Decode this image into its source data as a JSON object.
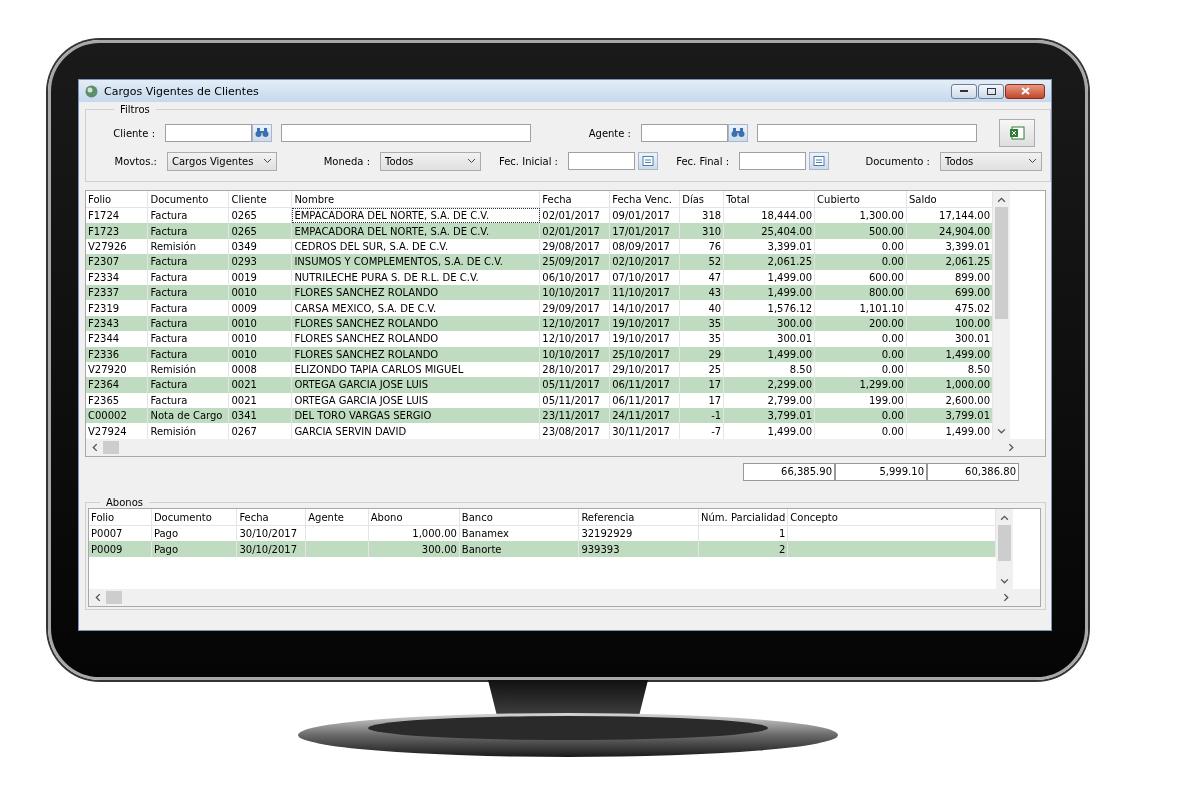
{
  "window": {
    "title": "Cargos Vigentes de Clientes"
  },
  "filters": {
    "title": "Filtros",
    "row_1": [
      {
        "kind": "lookup",
        "label": "Cliente :"
      },
      {
        "kind": "lookup",
        "label": "Agente :"
      },
      {
        "kind": "export"
      }
    ],
    "row_2": [
      {
        "kind": "combo",
        "label": "Movtos.:",
        "value": "Cargos Vigentes"
      },
      {
        "kind": "combo",
        "label": "Moneda :",
        "value": "Todos"
      },
      {
        "kind": "date",
        "label": "Fec. Inicial :"
      },
      {
        "kind": "date",
        "label": "Fec. Final :"
      },
      {
        "kind": "combo",
        "label": "Documento :",
        "value": "Todos"
      }
    ]
  },
  "table": {
    "columns": [
      {
        "label": "Folio",
        "kind": "text"
      },
      {
        "label": "Documento",
        "kind": "text"
      },
      {
        "label": "Cliente",
        "kind": "text"
      },
      {
        "label": "Nombre",
        "kind": "text"
      },
      {
        "label": "Fecha",
        "kind": "text"
      },
      {
        "label": "Fecha Venc.",
        "kind": "text"
      },
      {
        "label": "Días",
        "kind": "number"
      },
      {
        "label": "Total",
        "kind": "number"
      },
      {
        "label": "Cubierto",
        "kind": "number"
      },
      {
        "label": "Saldo",
        "kind": "number"
      }
    ],
    "rows": [
      {
        "cells": [
          "F1724",
          "Factura",
          "0265",
          "EMPACADORA DEL NORTE, S.A. DE C.V.",
          "02/01/2017",
          "09/01/2017",
          "318",
          "18,444.00",
          "1,300.00",
          "17,144.00"
        ],
        "focused": true
      },
      {
        "cells": [
          "F1723",
          "Factura",
          "0265",
          "EMPACADORA DEL NORTE, S.A. DE C.V.",
          "02/01/2017",
          "17/01/2017",
          "310",
          "25,404.00",
          "500.00",
          "24,904.00"
        ],
        "focused": false
      },
      {
        "cells": [
          "V27926",
          "Remisión",
          "0349",
          "CEDROS DEL SUR, S.A. DE C.V.",
          "29/08/2017",
          "08/09/2017",
          "76",
          "3,399.01",
          "0.00",
          "3,399.01"
        ],
        "focused": false
      },
      {
        "cells": [
          "F2307",
          "Factura",
          "0293",
          "INSUMOS Y COMPLEMENTOS, S.A. DE C.V.",
          "25/09/2017",
          "02/10/2017",
          "52",
          "2,061.25",
          "0.00",
          "2,061.25"
        ],
        "focused": false
      },
      {
        "cells": [
          "F2334",
          "Factura",
          "0019",
          "NUTRILECHE PURA S. DE R.L. DE C.V.",
          "06/10/2017",
          "07/10/2017",
          "47",
          "1,499.00",
          "600.00",
          "899.00"
        ],
        "focused": false
      },
      {
        "cells": [
          "F2337",
          "Factura",
          "0010",
          "FLORES SANCHEZ ROLANDO",
          "10/10/2017",
          "11/10/2017",
          "43",
          "1,499.00",
          "800.00",
          "699.00"
        ],
        "focused": false
      },
      {
        "cells": [
          "F2319",
          "Factura",
          "0009",
          "CARSA MEXICO, S.A. DE C.V.",
          "29/09/2017",
          "14/10/2017",
          "40",
          "1,576.12",
          "1,101.10",
          "475.02"
        ],
        "focused": false
      },
      {
        "cells": [
          "F2343",
          "Factura",
          "0010",
          "FLORES SANCHEZ ROLANDO",
          "12/10/2017",
          "19/10/2017",
          "35",
          "300.00",
          "200.00",
          "100.00"
        ],
        "focused": false
      },
      {
        "cells": [
          "F2344",
          "Factura",
          "0010",
          "FLORES SANCHEZ ROLANDO",
          "12/10/2017",
          "19/10/2017",
          "35",
          "300.01",
          "0.00",
          "300.01"
        ],
        "focused": false
      },
      {
        "cells": [
          "F2336",
          "Factura",
          "0010",
          "FLORES SANCHEZ ROLANDO",
          "10/10/2017",
          "25/10/2017",
          "29",
          "1,499.00",
          "0.00",
          "1,499.00"
        ],
        "focused": false
      },
      {
        "cells": [
          "V27920",
          "Remisión",
          "0008",
          "ELIZONDO TAPIA CARLOS MIGUEL",
          "28/10/2017",
          "29/10/2017",
          "25",
          "8.50",
          "0.00",
          "8.50"
        ],
        "focused": false
      },
      {
        "cells": [
          "F2364",
          "Factura",
          "0021",
          "ORTEGA GARCIA JOSE LUIS",
          "05/11/2017",
          "06/11/2017",
          "17",
          "2,299.00",
          "1,299.00",
          "1,000.00"
        ],
        "focused": false
      },
      {
        "cells": [
          "F2365",
          "Factura",
          "0021",
          "ORTEGA GARCIA JOSE LUIS",
          "05/11/2017",
          "06/11/2017",
          "17",
          "2,799.00",
          "199.00",
          "2,600.00"
        ],
        "focused": false
      },
      {
        "cells": [
          "C00002",
          "Nota de Cargo",
          "0341",
          "DEL TORO VARGAS SERGIO",
          "23/11/2017",
          "24/11/2017",
          "-1",
          "3,799.01",
          "0.00",
          "3,799.01"
        ],
        "focused": false
      },
      {
        "cells": [
          "V27924",
          "Remisión",
          "0267",
          "GARCIA SERVIN DAVID",
          "23/08/2017",
          "30/11/2017",
          "-7",
          "1,499.00",
          "0.00",
          "1,499.00"
        ],
        "focused": false
      }
    ],
    "totals": [
      "66,385.90",
      "5,999.10",
      "60,386.80"
    ]
  },
  "abonos": {
    "title": "Abonos",
    "columns": [
      {
        "label": "Folio",
        "kind": "text"
      },
      {
        "label": "Documento",
        "kind": "text"
      },
      {
        "label": "Fecha",
        "kind": "text"
      },
      {
        "label": "Agente",
        "kind": "text"
      },
      {
        "label": "Abono",
        "kind": "number"
      },
      {
        "label": "Banco",
        "kind": "text"
      },
      {
        "label": "Referencia",
        "kind": "text"
      },
      {
        "label": "Núm. Parcialidad",
        "kind": "number"
      },
      {
        "label": "Concepto",
        "kind": "text"
      }
    ],
    "rows": [
      {
        "cells": [
          "P0007",
          "Pago",
          "30/10/2017",
          "",
          "1,000.00",
          "Banamex",
          "32192929",
          "1",
          ""
        ]
      },
      {
        "cells": [
          "P0009",
          "Pago",
          "30/10/2017",
          "",
          "300.00",
          "Banorte",
          "939393",
          "2",
          ""
        ]
      }
    ]
  }
}
